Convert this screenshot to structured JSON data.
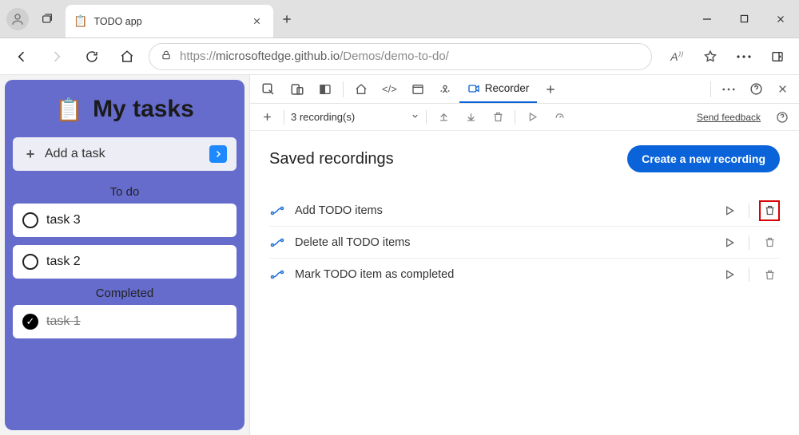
{
  "tab": {
    "title": "TODO app"
  },
  "address": {
    "scheme": "https://",
    "host": "microsoftedge.github.io",
    "path": "/Demos/demo-to-do/"
  },
  "app": {
    "title": "My tasks",
    "add_placeholder": "Add a task",
    "sections": {
      "todo": "To do",
      "completed": "Completed"
    },
    "todo": [
      "task 3",
      "task 2"
    ],
    "completed": [
      "task 1"
    ]
  },
  "devtools": {
    "tabs": {
      "recorder": "Recorder"
    },
    "recordings_count_label": "3 recording(s)",
    "feedback_label": "Send feedback",
    "heading": "Saved recordings",
    "cta": "Create a new recording",
    "recordings": [
      {
        "name": "Add TODO items",
        "highlight_delete": true
      },
      {
        "name": "Delete all TODO items",
        "highlight_delete": false
      },
      {
        "name": "Mark TODO item as completed",
        "highlight_delete": false
      }
    ]
  }
}
